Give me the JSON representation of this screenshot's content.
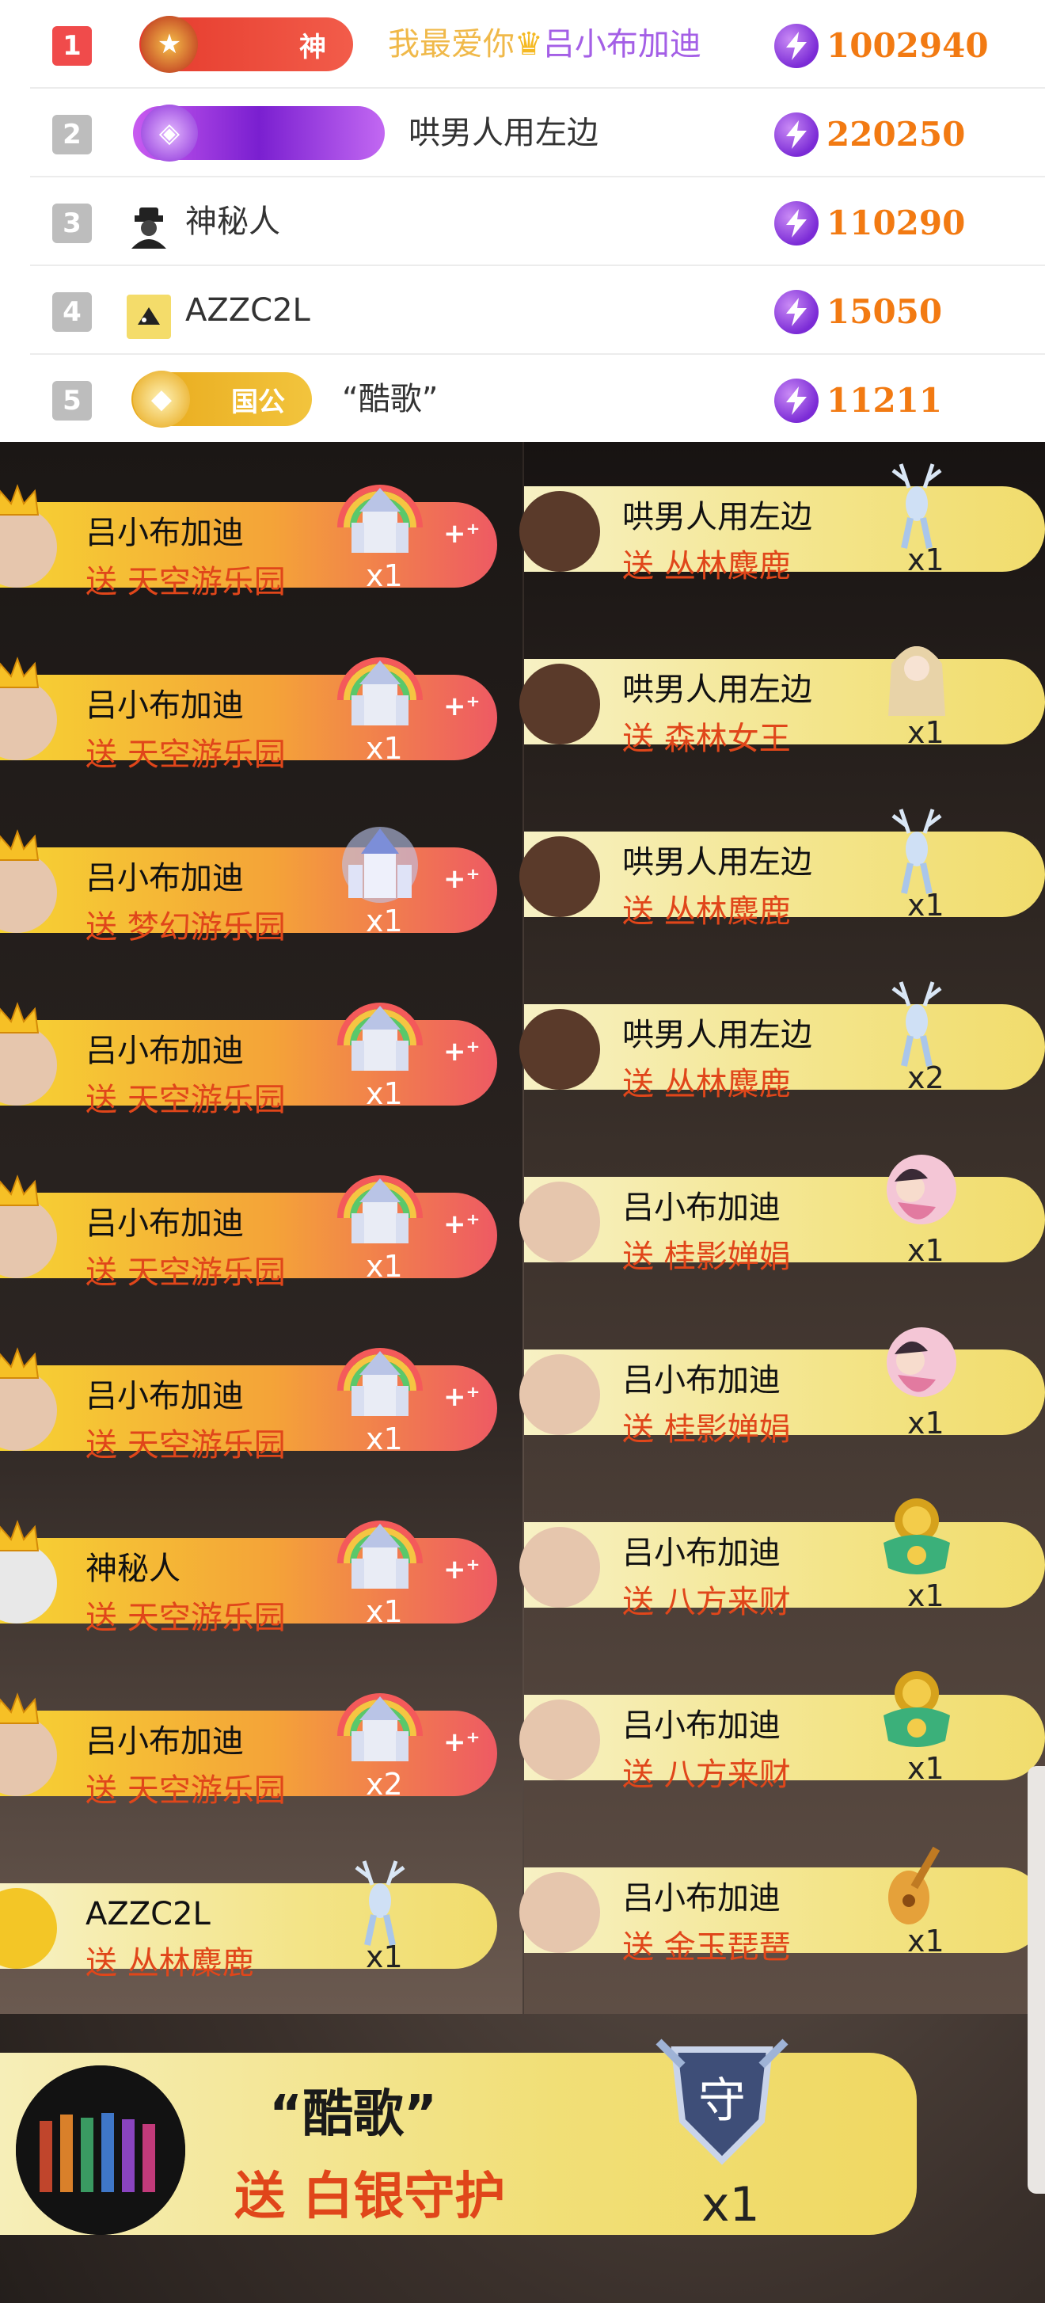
{
  "ranking": {
    "rows": [
      {
        "rank": "1",
        "rank_color": "#f04b4b",
        "badge_label": "神",
        "name_parts": [
          {
            "text": "我最爱你",
            "color": "#f0b94a"
          },
          {
            "text": "吕小布加迪",
            "color": "#a45fe6"
          }
        ],
        "score": "1002940"
      },
      {
        "rank": "2",
        "rank_color": "#bdbdbd",
        "badge_label": "",
        "name_parts": [
          {
            "text": "哄男人用左边",
            "color": "#333333"
          }
        ],
        "score": "220250"
      },
      {
        "rank": "3",
        "rank_color": "#bdbdbd",
        "badge_label": "",
        "name_parts": [
          {
            "text": "神秘人",
            "color": "#333333"
          }
        ],
        "score": "110290"
      },
      {
        "rank": "4",
        "rank_color": "#bdbdbd",
        "badge_label": "",
        "name_parts": [
          {
            "text": "AZZC2L",
            "color": "#333333"
          }
        ],
        "score": "15050"
      },
      {
        "rank": "5",
        "rank_color": "#bdbdbd",
        "badge_label": "国公",
        "name_parts": [
          {
            "text": "“酷歌”",
            "color": "#333333"
          }
        ],
        "score": "11211"
      }
    ]
  },
  "gifts_left": [
    {
      "sender": "吕小布加迪",
      "gift": "送 天空游乐园",
      "qty": "x1",
      "icon": "rainbow-castle-icon"
    },
    {
      "sender": "吕小布加迪",
      "gift": "送 天空游乐园",
      "qty": "x1",
      "icon": "rainbow-castle-icon"
    },
    {
      "sender": "吕小布加迪",
      "gift": "送 梦幻游乐园",
      "qty": "x1",
      "icon": "dream-castle-icon"
    },
    {
      "sender": "吕小布加迪",
      "gift": "送 天空游乐园",
      "qty": "x1",
      "icon": "rainbow-castle-icon"
    },
    {
      "sender": "吕小布加迪",
      "gift": "送 天空游乐园",
      "qty": "x1",
      "icon": "rainbow-castle-icon"
    },
    {
      "sender": "吕小布加迪",
      "gift": "送 天空游乐园",
      "qty": "x1",
      "icon": "rainbow-castle-icon"
    },
    {
      "sender": "神秘人",
      "gift": "送 天空游乐园",
      "qty": "x1",
      "icon": "rainbow-castle-icon"
    },
    {
      "sender": "吕小布加迪",
      "gift": "送 天空游乐园",
      "qty": "x2",
      "icon": "rainbow-castle-icon"
    },
    {
      "sender": "AZZC2L",
      "gift": "送 丛林麋鹿",
      "qty": "x1",
      "icon": "elk-icon"
    }
  ],
  "gifts_right": [
    {
      "sender": "哄男人用左边",
      "gift": "送 丛林麋鹿",
      "qty": "x1",
      "icon": "elk-icon"
    },
    {
      "sender": "哄男人用左边",
      "gift": "送 森林女王",
      "qty": "x1",
      "icon": "forest-queen-icon"
    },
    {
      "sender": "哄男人用左边",
      "gift": "送 丛林麋鹿",
      "qty": "x1",
      "icon": "elk-icon"
    },
    {
      "sender": "哄男人用左边",
      "gift": "送 丛林麋鹿",
      "qty": "x2",
      "icon": "elk-icon"
    },
    {
      "sender": "吕小布加迪",
      "gift": "送 桂影婵娟",
      "qty": "x1",
      "icon": "moon-fairy-icon"
    },
    {
      "sender": "吕小布加迪",
      "gift": "送 桂影婵娟",
      "qty": "x1",
      "icon": "moon-fairy-icon"
    },
    {
      "sender": "吕小布加迪",
      "gift": "送 八方来财",
      "qty": "x1",
      "icon": "gold-treasure-icon"
    },
    {
      "sender": "吕小布加迪",
      "gift": "送 八方来财",
      "qty": "x1",
      "icon": "gold-treasure-icon"
    },
    {
      "sender": "吕小布加迪",
      "gift": "送 金玉琵琶",
      "qty": "x1",
      "icon": "golden-pipa-icon"
    }
  ],
  "featured_gift": {
    "sender": "“酷歌”",
    "gift": "送 白银守护",
    "qty": "x1",
    "shield_char": "守",
    "icon": "silver-guard-shield-icon"
  },
  "colors": {
    "score": "#f27a12",
    "gift_text": "#e0461a",
    "coin": "#7b2bd6"
  }
}
